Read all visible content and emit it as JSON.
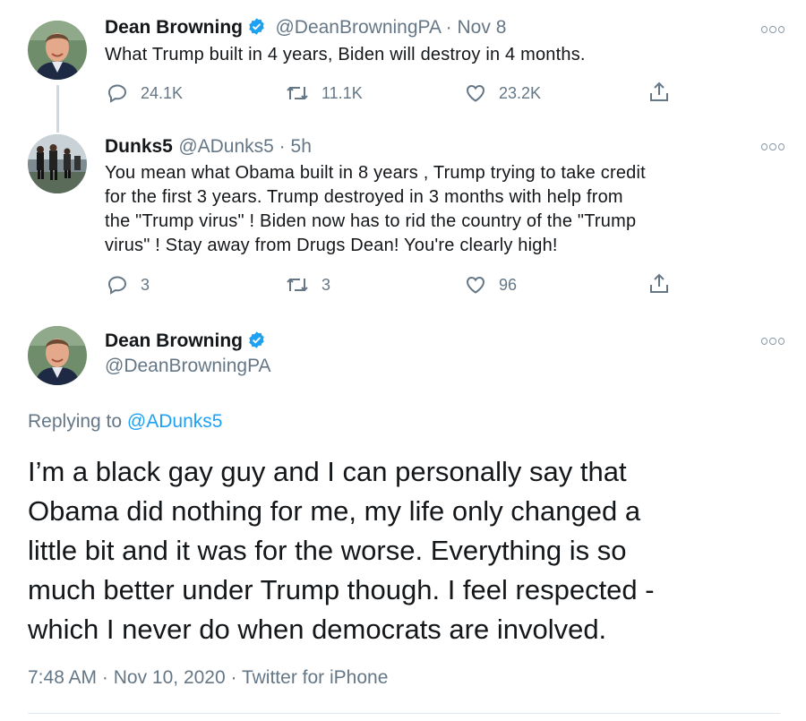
{
  "tweet1": {
    "name": "Dean Browning",
    "handle": "@DeanBrowningPA",
    "sep": " · ",
    "date": "Nov 8",
    "text": "What Trump built in 4 years, Biden will destroy in 4 months.",
    "replies": "24.1K",
    "retweets": "11.1K",
    "likes": "23.2K"
  },
  "tweet2": {
    "name": "Dunks5",
    "handle": "@ADunks5",
    "sep": " · ",
    "date": "5h",
    "lines": [
      "You mean what Obama built in 8 years , Trump trying to take credit",
      "for the first 3 years. Trump destroyed in 3 months with help from",
      "the \"Trump virus\" ! Biden now has to rid the country of the \"Trump",
      "virus\" ! Stay away from Drugs Dean! You're clearly high!"
    ],
    "replies": "3",
    "retweets": "3",
    "likes": "96"
  },
  "tweet3": {
    "name": "Dean Browning",
    "handle": "@DeanBrowningPA",
    "replying_prefix": "Replying to ",
    "replying_handle": "@ADunks5",
    "lines": [
      "I’m a black gay guy and I can personally say that",
      "Obama did nothing for me, my life only changed a",
      "little bit and it was for the worse. Everything is so",
      "much better under Trump though. I feel respected -",
      "which I never do when democrats are involved."
    ],
    "time": "7:48 AM",
    "sep": " · ",
    "date": "Nov 10, 2020",
    "sep2": " · ",
    "source": "Twitter for iPhone"
  },
  "colors": {
    "link": "#1da1f2",
    "secondary": "#657786",
    "verified": "#1da1f2"
  },
  "icons": [
    "reply-icon",
    "retweet-icon",
    "like-icon",
    "share-icon",
    "verified-icon",
    "more-icon"
  ]
}
